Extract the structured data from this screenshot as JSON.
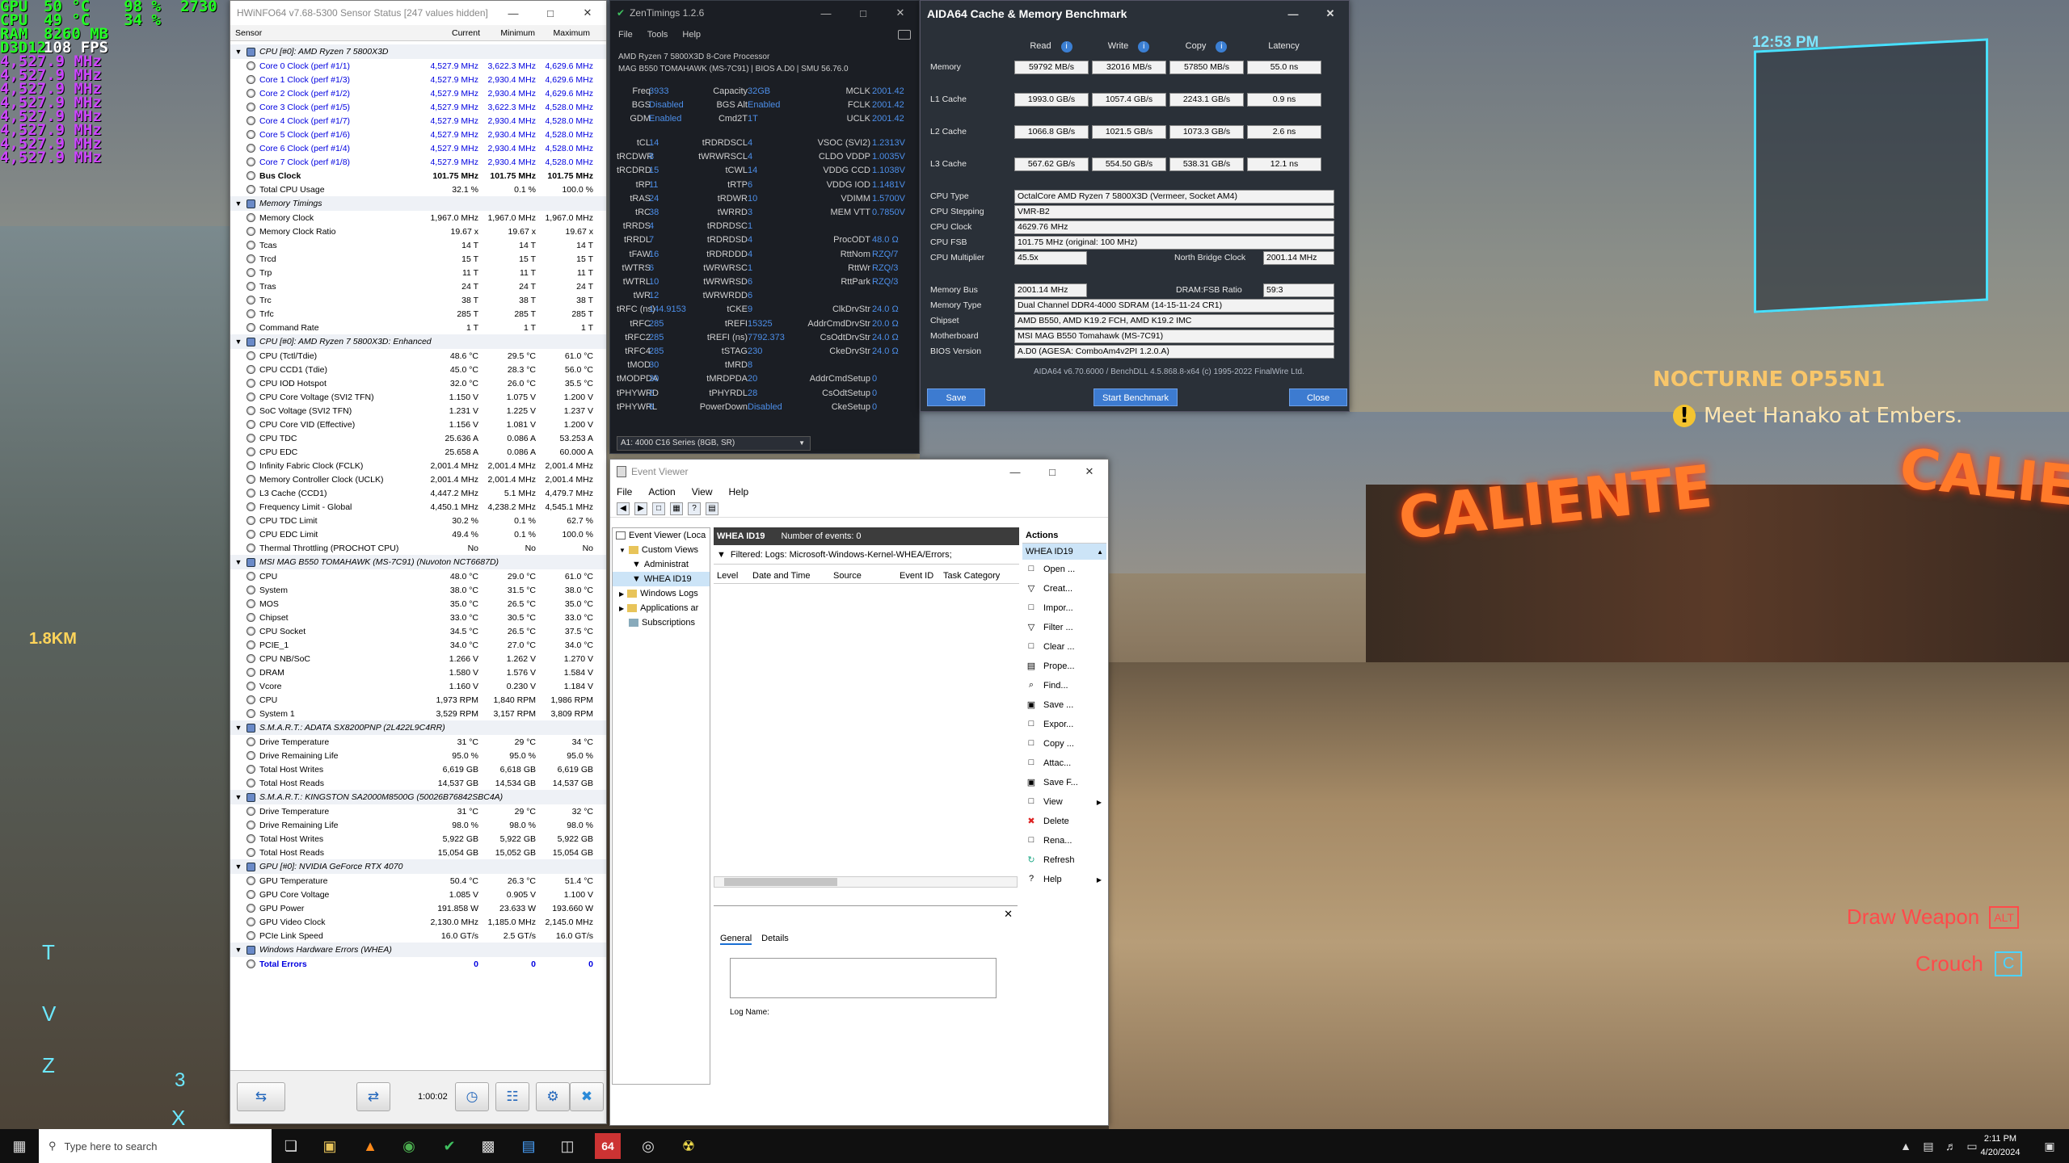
{
  "osd": {
    "rows": [
      {
        "label": "GPU",
        "a": "50 °C",
        "b": "98 %",
        "c": "2730"
      },
      {
        "label": "CPU",
        "a": "49 °C",
        "b": "34 %",
        "c": ""
      },
      {
        "label": "RAM",
        "a": "8260 MB",
        "b": "",
        "c": ""
      },
      {
        "label": "D3D12",
        "a": "108 FPS",
        "b": "",
        "c": ""
      }
    ],
    "clocks": [
      "4,527.9 MHz",
      "4,527.9 MHz",
      "4,527.9 MHz",
      "4,527.9 MHz",
      "4,527.9 MHz",
      "4,527.9 MHz",
      "4,527.9 MHz",
      "4,527.9 MHz"
    ]
  },
  "game": {
    "clock": "12:53 PM",
    "gig_title": "NOCTURNE OP55N1",
    "gig_objective": "Meet Hanako at Embers.",
    "sign1": "CALIENTE",
    "sign2": "CALIENTE",
    "distance": "1.8KM",
    "hint_draw": "Draw Weapon",
    "hint_draw_key": "ALT",
    "hint_crouch": "Crouch",
    "hint_crouch_key": "C",
    "quick_keys": [
      "T",
      "V",
      "Z",
      "X",
      "3"
    ]
  },
  "hwinfo": {
    "title": "HWiNFO64 v7.68-5300 Sensor Status [247 values hidden]",
    "cols": [
      "Sensor",
      "Current",
      "Minimum",
      "Maximum"
    ],
    "groups": [
      {
        "name": "CPU [#0]: AMD Ryzen 7 5800X3D",
        "rows": [
          [
            "Core 0 Clock (perf #1/1)",
            "4,527.9 MHz",
            "3,622.3 MHz",
            "4,629.6 MHz",
            "blue"
          ],
          [
            "Core 1 Clock (perf #1/3)",
            "4,527.9 MHz",
            "2,930.4 MHz",
            "4,629.6 MHz",
            "blue"
          ],
          [
            "Core 2 Clock (perf #1/2)",
            "4,527.9 MHz",
            "2,930.4 MHz",
            "4,629.6 MHz",
            "blue"
          ],
          [
            "Core 3 Clock (perf #1/5)",
            "4,527.9 MHz",
            "3,622.3 MHz",
            "4,528.0 MHz",
            "blue"
          ],
          [
            "Core 4 Clock (perf #1/7)",
            "4,527.9 MHz",
            "2,930.4 MHz",
            "4,528.0 MHz",
            "blue"
          ],
          [
            "Core 5 Clock (perf #1/6)",
            "4,527.9 MHz",
            "2,930.4 MHz",
            "4,528.0 MHz",
            "blue"
          ],
          [
            "Core 6 Clock (perf #1/4)",
            "4,527.9 MHz",
            "2,930.4 MHz",
            "4,528.0 MHz",
            "blue"
          ],
          [
            "Core 7 Clock (perf #1/8)",
            "4,527.9 MHz",
            "2,930.4 MHz",
            "4,528.0 MHz",
            "blue"
          ],
          [
            "Bus Clock",
            "101.75 MHz",
            "101.75 MHz",
            "101.75 MHz",
            "bold"
          ],
          [
            "Total CPU Usage",
            "32.1 %",
            "0.1 %",
            "100.0 %",
            ""
          ]
        ]
      },
      {
        "name": "Memory Timings",
        "rows": [
          [
            "Memory Clock",
            "1,967.0 MHz",
            "1,967.0 MHz",
            "1,967.0 MHz",
            ""
          ],
          [
            "Memory Clock Ratio",
            "19.67 x",
            "19.67 x",
            "19.67 x",
            ""
          ],
          [
            "Tcas",
            "14 T",
            "14 T",
            "14 T",
            ""
          ],
          [
            "Trcd",
            "15 T",
            "15 T",
            "15 T",
            ""
          ],
          [
            "Trp",
            "11 T",
            "11 T",
            "11 T",
            ""
          ],
          [
            "Tras",
            "24 T",
            "24 T",
            "24 T",
            ""
          ],
          [
            "Trc",
            "38 T",
            "38 T",
            "38 T",
            ""
          ],
          [
            "Trfc",
            "285 T",
            "285 T",
            "285 T",
            ""
          ],
          [
            "Command Rate",
            "1 T",
            "1 T",
            "1 T",
            ""
          ]
        ]
      },
      {
        "name": "CPU [#0]: AMD Ryzen 7 5800X3D: Enhanced",
        "rows": [
          [
            "CPU (Tctl/Tdie)",
            "48.6 °C",
            "29.5 °C",
            "61.0 °C",
            ""
          ],
          [
            "CPU CCD1 (Tdie)",
            "45.0 °C",
            "28.3 °C",
            "56.0 °C",
            ""
          ],
          [
            "CPU IOD Hotspot",
            "32.0 °C",
            "26.0 °C",
            "35.5 °C",
            ""
          ],
          [
            "CPU Core Voltage (SVI2 TFN)",
            "1.150 V",
            "1.075 V",
            "1.200 V",
            ""
          ],
          [
            "SoC Voltage (SVI2 TFN)",
            "1.231 V",
            "1.225 V",
            "1.237 V",
            ""
          ],
          [
            "CPU Core VID (Effective)",
            "1.156 V",
            "1.081 V",
            "1.200 V",
            ""
          ],
          [
            "CPU TDC",
            "25.636 A",
            "0.086 A",
            "53.253 A",
            ""
          ],
          [
            "CPU EDC",
            "25.658 A",
            "0.086 A",
            "60.000 A",
            ""
          ],
          [
            "Infinity Fabric Clock (FCLK)",
            "2,001.4 MHz",
            "2,001.4 MHz",
            "2,001.4 MHz",
            ""
          ],
          [
            "Memory Controller Clock (UCLK)",
            "2,001.4 MHz",
            "2,001.4 MHz",
            "2,001.4 MHz",
            ""
          ],
          [
            "   L3 Cache (CCD1)",
            "4,447.2 MHz",
            "5.1 MHz",
            "4,479.7 MHz",
            ""
          ],
          [
            "Frequency Limit - Global",
            "4,450.1 MHz",
            "4,238.2 MHz",
            "4,545.1 MHz",
            ""
          ],
          [
            "CPU TDC Limit",
            "30.2 %",
            "0.1 %",
            "62.7 %",
            ""
          ],
          [
            "CPU EDC Limit",
            "49.4 %",
            "0.1 %",
            "100.0 %",
            ""
          ],
          [
            "Thermal Throttling (PROCHOT CPU)",
            "No",
            "No",
            "No",
            ""
          ]
        ]
      },
      {
        "name": "MSI MAG B550 TOMAHAWK (MS-7C91) (Nuvoton NCT6687D)",
        "rows": [
          [
            "CPU",
            "48.0 °C",
            "29.0 °C",
            "61.0 °C",
            ""
          ],
          [
            "System",
            "38.0 °C",
            "31.5 °C",
            "38.0 °C",
            ""
          ],
          [
            "MOS",
            "35.0 °C",
            "26.5 °C",
            "35.0 °C",
            ""
          ],
          [
            "Chipset",
            "33.0 °C",
            "30.5 °C",
            "33.0 °C",
            ""
          ],
          [
            "CPU Socket",
            "34.5 °C",
            "26.5 °C",
            "37.5 °C",
            ""
          ],
          [
            "PCIE_1",
            "34.0 °C",
            "27.0 °C",
            "34.0 °C",
            ""
          ],
          [
            "CPU NB/SoC",
            "1.266 V",
            "1.262 V",
            "1.270 V",
            ""
          ],
          [
            "DRAM",
            "1.580 V",
            "1.576 V",
            "1.584 V",
            ""
          ],
          [
            "Vcore",
            "1.160 V",
            "0.230 V",
            "1.184 V",
            ""
          ],
          [
            "CPU",
            "1,973 RPM",
            "1,840 RPM",
            "1,986 RPM",
            ""
          ],
          [
            "System 1",
            "3,529 RPM",
            "3,157 RPM",
            "3,809 RPM",
            ""
          ]
        ]
      },
      {
        "name": "S.M.A.R.T.: ADATA SX8200PNP (2L422L9C4RR)",
        "rows": [
          [
            "Drive Temperature",
            "31 °C",
            "29 °C",
            "34 °C",
            ""
          ],
          [
            "Drive Remaining Life",
            "95.0 %",
            "95.0 %",
            "95.0 %",
            ""
          ],
          [
            "Total Host Writes",
            "6,619 GB",
            "6,618 GB",
            "6,619 GB",
            ""
          ],
          [
            "Total Host Reads",
            "14,537 GB",
            "14,534 GB",
            "14,537 GB",
            ""
          ]
        ]
      },
      {
        "name": "S.M.A.R.T.: KINGSTON SA2000M8500G (50026B76842SBC4A)",
        "rows": [
          [
            "Drive Temperature",
            "31 °C",
            "29 °C",
            "32 °C",
            ""
          ],
          [
            "Drive Remaining Life",
            "98.0 %",
            "98.0 %",
            "98.0 %",
            ""
          ],
          [
            "Total Host Writes",
            "5,922 GB",
            "5,922 GB",
            "5,922 GB",
            ""
          ],
          [
            "Total Host Reads",
            "15,054 GB",
            "15,052 GB",
            "15,054 GB",
            ""
          ]
        ]
      },
      {
        "name": "GPU [#0]: NVIDIA GeForce RTX 4070",
        "rows": [
          [
            "GPU Temperature",
            "50.4 °C",
            "26.3 °C",
            "51.4 °C",
            ""
          ],
          [
            "GPU Core Voltage",
            "1.085 V",
            "0.905 V",
            "1.100 V",
            ""
          ],
          [
            "GPU Power",
            "191.858 W",
            "23.633 W",
            "193.660 W",
            ""
          ],
          [
            "GPU Video Clock",
            "2,130.0 MHz",
            "1,185.0 MHz",
            "2,145.0 MHz",
            ""
          ],
          [
            "PCIe Link Speed",
            "16.0 GT/s",
            "2.5 GT/s",
            "16.0 GT/s",
            ""
          ]
        ]
      },
      {
        "name": "Windows Hardware Errors (WHEA)",
        "rows": [
          [
            "Total Errors",
            "0",
            "0",
            "0",
            "blue bold"
          ]
        ]
      }
    ],
    "elapsed": "1:00:02"
  },
  "zen": {
    "title": "ZenTimings 1.2.6",
    "menu": [
      "File",
      "Tools",
      "Help"
    ],
    "cpu": "AMD Ryzen 7 5800X3D 8-Core Processor",
    "board": "MAG B550 TOMAHAWK (MS-7C91) | BIOS A.D0 | SMU 56.76.0",
    "top": [
      [
        "Freq",
        "3933",
        "Capacity",
        "32GB",
        "MCLK",
        "2001.42"
      ],
      [
        "BGS",
        "Disabled",
        "BGS Alt",
        "Enabled",
        "FCLK",
        "2001.42"
      ],
      [
        "GDM",
        "Enabled",
        "Cmd2T",
        "1T",
        "UCLK",
        "2001.42"
      ]
    ],
    "timings": [
      [
        "tCL",
        "14",
        "tRDRDSCL",
        "4",
        "VSOC (SVI2)",
        "1.2313V"
      ],
      [
        "tRCDWR",
        "8",
        "tWRWRSCL",
        "4",
        "CLDO VDDP",
        "1.0035V"
      ],
      [
        "tRCDRD",
        "15",
        "tCWL",
        "14",
        "VDDG CCD",
        "1.1038V"
      ],
      [
        "tRP",
        "11",
        "tRTP",
        "6",
        "VDDG IOD",
        "1.1481V"
      ],
      [
        "tRAS",
        "24",
        "tRDWR",
        "10",
        "VDIMM",
        "1.5700V"
      ],
      [
        "tRC",
        "38",
        "tWRRD",
        "3",
        "MEM VTT",
        "0.7850V"
      ],
      [
        "tRRDS",
        "4",
        "tRDRDSC",
        "1",
        "",
        ""
      ],
      [
        "tRRDL",
        "7",
        "tRDRDSD",
        "4",
        "ProcODT",
        "48.0 Ω"
      ],
      [
        "tFAW",
        "16",
        "tRDRDDD",
        "4",
        "RttNom",
        "RZQ/7"
      ],
      [
        "tWTRS",
        "6",
        "tWRWRSC",
        "1",
        "RttWr",
        "RZQ/3"
      ],
      [
        "tWTRL",
        "10",
        "tWRWRSD",
        "6",
        "RttPark",
        "RZQ/3"
      ],
      [
        "tWR",
        "12",
        "tWRWRDD",
        "6",
        "",
        ""
      ],
      [
        "tRFC (ns)",
        "144.9153",
        "tCKE",
        "9",
        "ClkDrvStr",
        "24.0 Ω"
      ],
      [
        "tRFC",
        "285",
        "tREFI",
        "15325",
        "AddrCmdDrvStr",
        "20.0 Ω"
      ],
      [
        "tRFC2",
        "285",
        "tREFI (ns)",
        "7792.373",
        "CsOdtDrvStr",
        "24.0 Ω"
      ],
      [
        "tRFC4",
        "285",
        "tSTAG",
        "230",
        "CkeDrvStr",
        "24.0 Ω"
      ],
      [
        "tMOD",
        "30",
        "tMRD",
        "8",
        "",
        ""
      ],
      [
        "tMODPDA",
        "30",
        "tMRDPDA",
        "20",
        "AddrCmdSetup",
        "0"
      ],
      [
        "tPHYWRD",
        "2",
        "tPHYRDL",
        "28",
        "CsOdtSetup",
        "0"
      ],
      [
        "tPHYWRL",
        "9",
        "PowerDown",
        "Disabled",
        "CkeSetup",
        "0"
      ]
    ],
    "profile": "A1: 4000 C16 Series (8GB, SR)"
  },
  "aida": {
    "title": "AIDA64 Cache & Memory Benchmark",
    "heads": [
      "Read",
      "Write",
      "Copy",
      "Latency"
    ],
    "rows": [
      [
        "Memory",
        "59792 MB/s",
        "32016 MB/s",
        "57850 MB/s",
        "55.0 ns"
      ],
      [
        "L1 Cache",
        "1993.0 GB/s",
        "1057.4 GB/s",
        "2243.1 GB/s",
        "0.9 ns"
      ],
      [
        "L2 Cache",
        "1066.8 GB/s",
        "1021.5 GB/s",
        "1073.3 GB/s",
        "2.6 ns"
      ],
      [
        "L3 Cache",
        "567.62 GB/s",
        "554.50 GB/s",
        "538.31 GB/s",
        "12.1 ns"
      ]
    ],
    "info": [
      [
        "CPU Type",
        "OctalCore AMD Ryzen 7 5800X3D  (Vermeer, Socket AM4)"
      ],
      [
        "CPU Stepping",
        "VMR-B2"
      ],
      [
        "CPU Clock",
        "4629.76 MHz"
      ],
      [
        "CPU FSB",
        "101.75 MHz  (original: 100 MHz)"
      ],
      [
        "CPU Multiplier",
        "45.5x"
      ]
    ],
    "nb_label": "North Bridge Clock",
    "nb_value": "2001.14 MHz",
    "membus_label": "Memory Bus",
    "membus_value": "2001.14 MHz",
    "ratio_label": "DRAM:FSB Ratio",
    "ratio_value": "59:3",
    "info2": [
      [
        "Memory Type",
        "Dual Channel DDR4-4000 SDRAM  (14-15-11-24 CR1)"
      ],
      [
        "Chipset",
        "AMD B550, AMD K19.2 FCH, AMD K19.2 IMC"
      ],
      [
        "Motherboard",
        "MSI MAG B550 Tomahawk (MS-7C91)"
      ],
      [
        "BIOS Version",
        "A.D0  (AGESA: ComboAm4v2PI 1.2.0.A)"
      ]
    ],
    "footer": "AIDA64 v6.70.6000 / BenchDLL 4.5.868.8-x64  (c) 1995-2022 FinalWire Ltd.",
    "btn_save": "Save",
    "btn_start": "Start Benchmark",
    "btn_close": "Close"
  },
  "event": {
    "title": "Event Viewer",
    "menu": [
      "File",
      "Action",
      "View",
      "Help"
    ],
    "tree": [
      "Event Viewer (Loca",
      "Custom Views",
      "Administrat",
      "WHEA ID19",
      "Windows Logs",
      "Applications ar",
      "Subscriptions"
    ],
    "view_title": "WHEA ID19",
    "view_count": "Number of events: 0",
    "filter": "Filtered: Logs: Microsoft-Windows-Kernel-WHEA/Errors;",
    "cols": [
      "Level",
      "Date and Time",
      "Source",
      "Event ID",
      "Task Category"
    ],
    "tabs": [
      "General",
      "Details"
    ],
    "logname": "Log Name:",
    "actions_title": "Actions",
    "actions_sub": "WHEA ID19",
    "actions": [
      "Open ...",
      "Creat...",
      "Impor...",
      "Filter ...",
      "Clear ...",
      "Prope...",
      "Find...",
      "Save ...",
      "Expor...",
      "Copy ...",
      "Attac...",
      "Save F...",
      "View",
      "Delete",
      "Rena...",
      "Refresh",
      "Help"
    ]
  },
  "taskbar": {
    "search": "Type here to search",
    "time": "2:11 PM",
    "date": "4/20/2024"
  }
}
